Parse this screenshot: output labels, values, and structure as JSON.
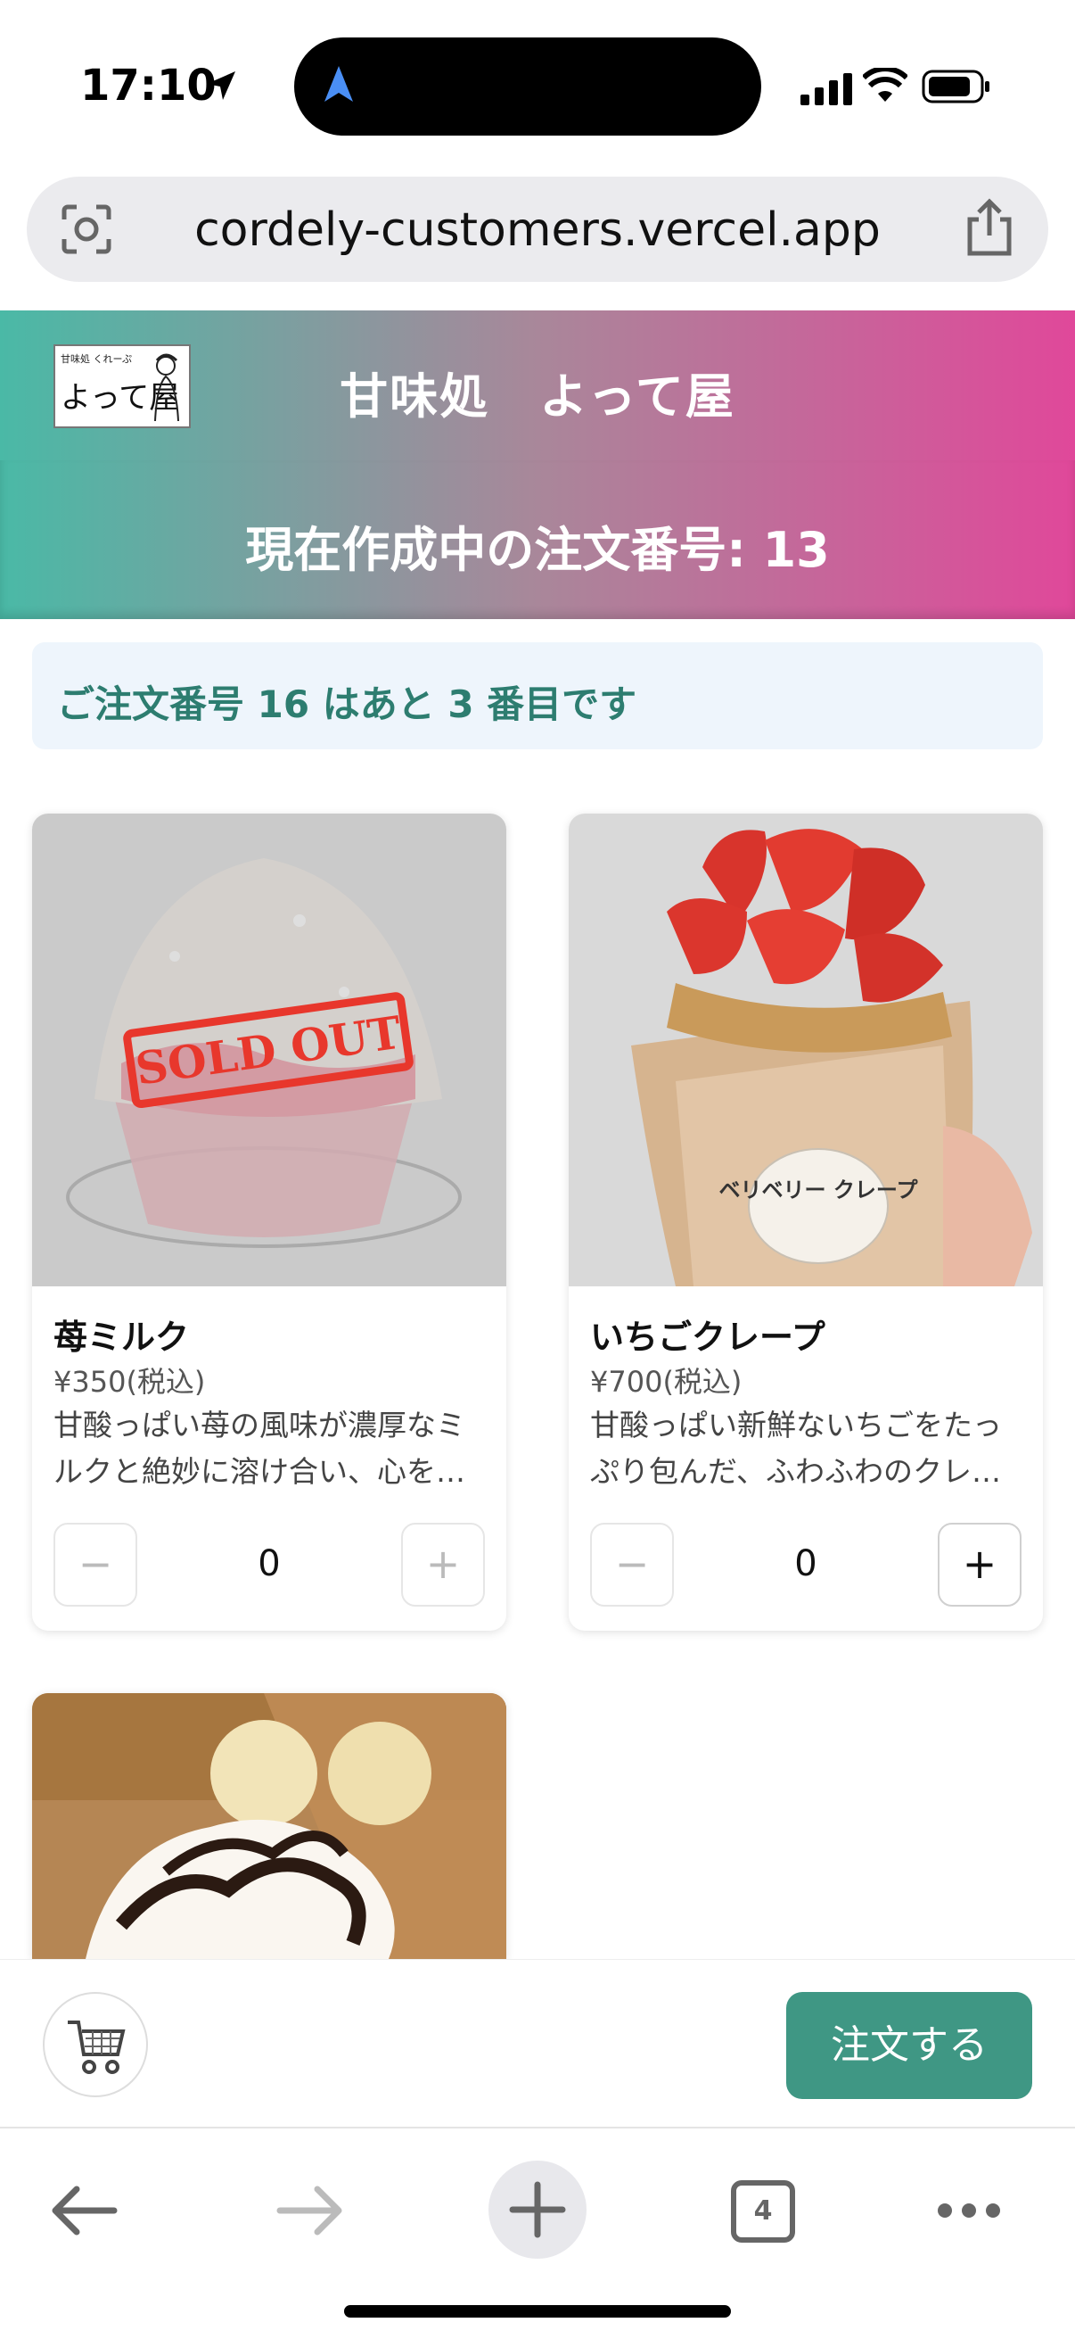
{
  "status_bar": {
    "time": "17:10"
  },
  "url_bar": {
    "url": "cordely-customers.vercel.app"
  },
  "header": {
    "shop_title": "甘味処　よって屋",
    "logo_small_text": "甘味処 くれーぷ",
    "logo_main_text": "よって屋"
  },
  "order_banner": {
    "text": "現在作成中の注文番号: 13"
  },
  "queue_notice": {
    "text": "ご注文番号 16 はあと 3 番目です"
  },
  "products": [
    {
      "name": "苺ミルク",
      "price": "¥350(税込)",
      "description": "甘酸っぱい苺の風味が濃厚なミルクと絶妙に溶け合い、心を…",
      "quantity": "0",
      "sold_out": true,
      "sold_out_label": "SOLD OUT",
      "image": "strawberry-shaved-ice"
    },
    {
      "name": "いちごクレープ",
      "price": "¥700(税込)",
      "description": "甘酸っぱい新鮮ないちごをたっぷり包んだ、ふわふわのクレ…",
      "quantity": "0",
      "sold_out": false,
      "image": "strawberry-crepe",
      "wrapper_text": "ベリベリー クレープ"
    },
    {
      "image": "banana-chocolate-crepe"
    }
  ],
  "stepper": {
    "minus": "−",
    "plus": "+"
  },
  "action_bar": {
    "order_button": "注文する",
    "cart_icon": "shopping-cart-icon"
  },
  "browser_toolbar": {
    "tab_count": "4"
  },
  "colors": {
    "header_gradient_start": "#4ab9a6",
    "header_gradient_end": "#e0489a",
    "accent": "#3f9784",
    "notice_bg": "#eef5fc",
    "notice_text": "#2d7d70"
  }
}
